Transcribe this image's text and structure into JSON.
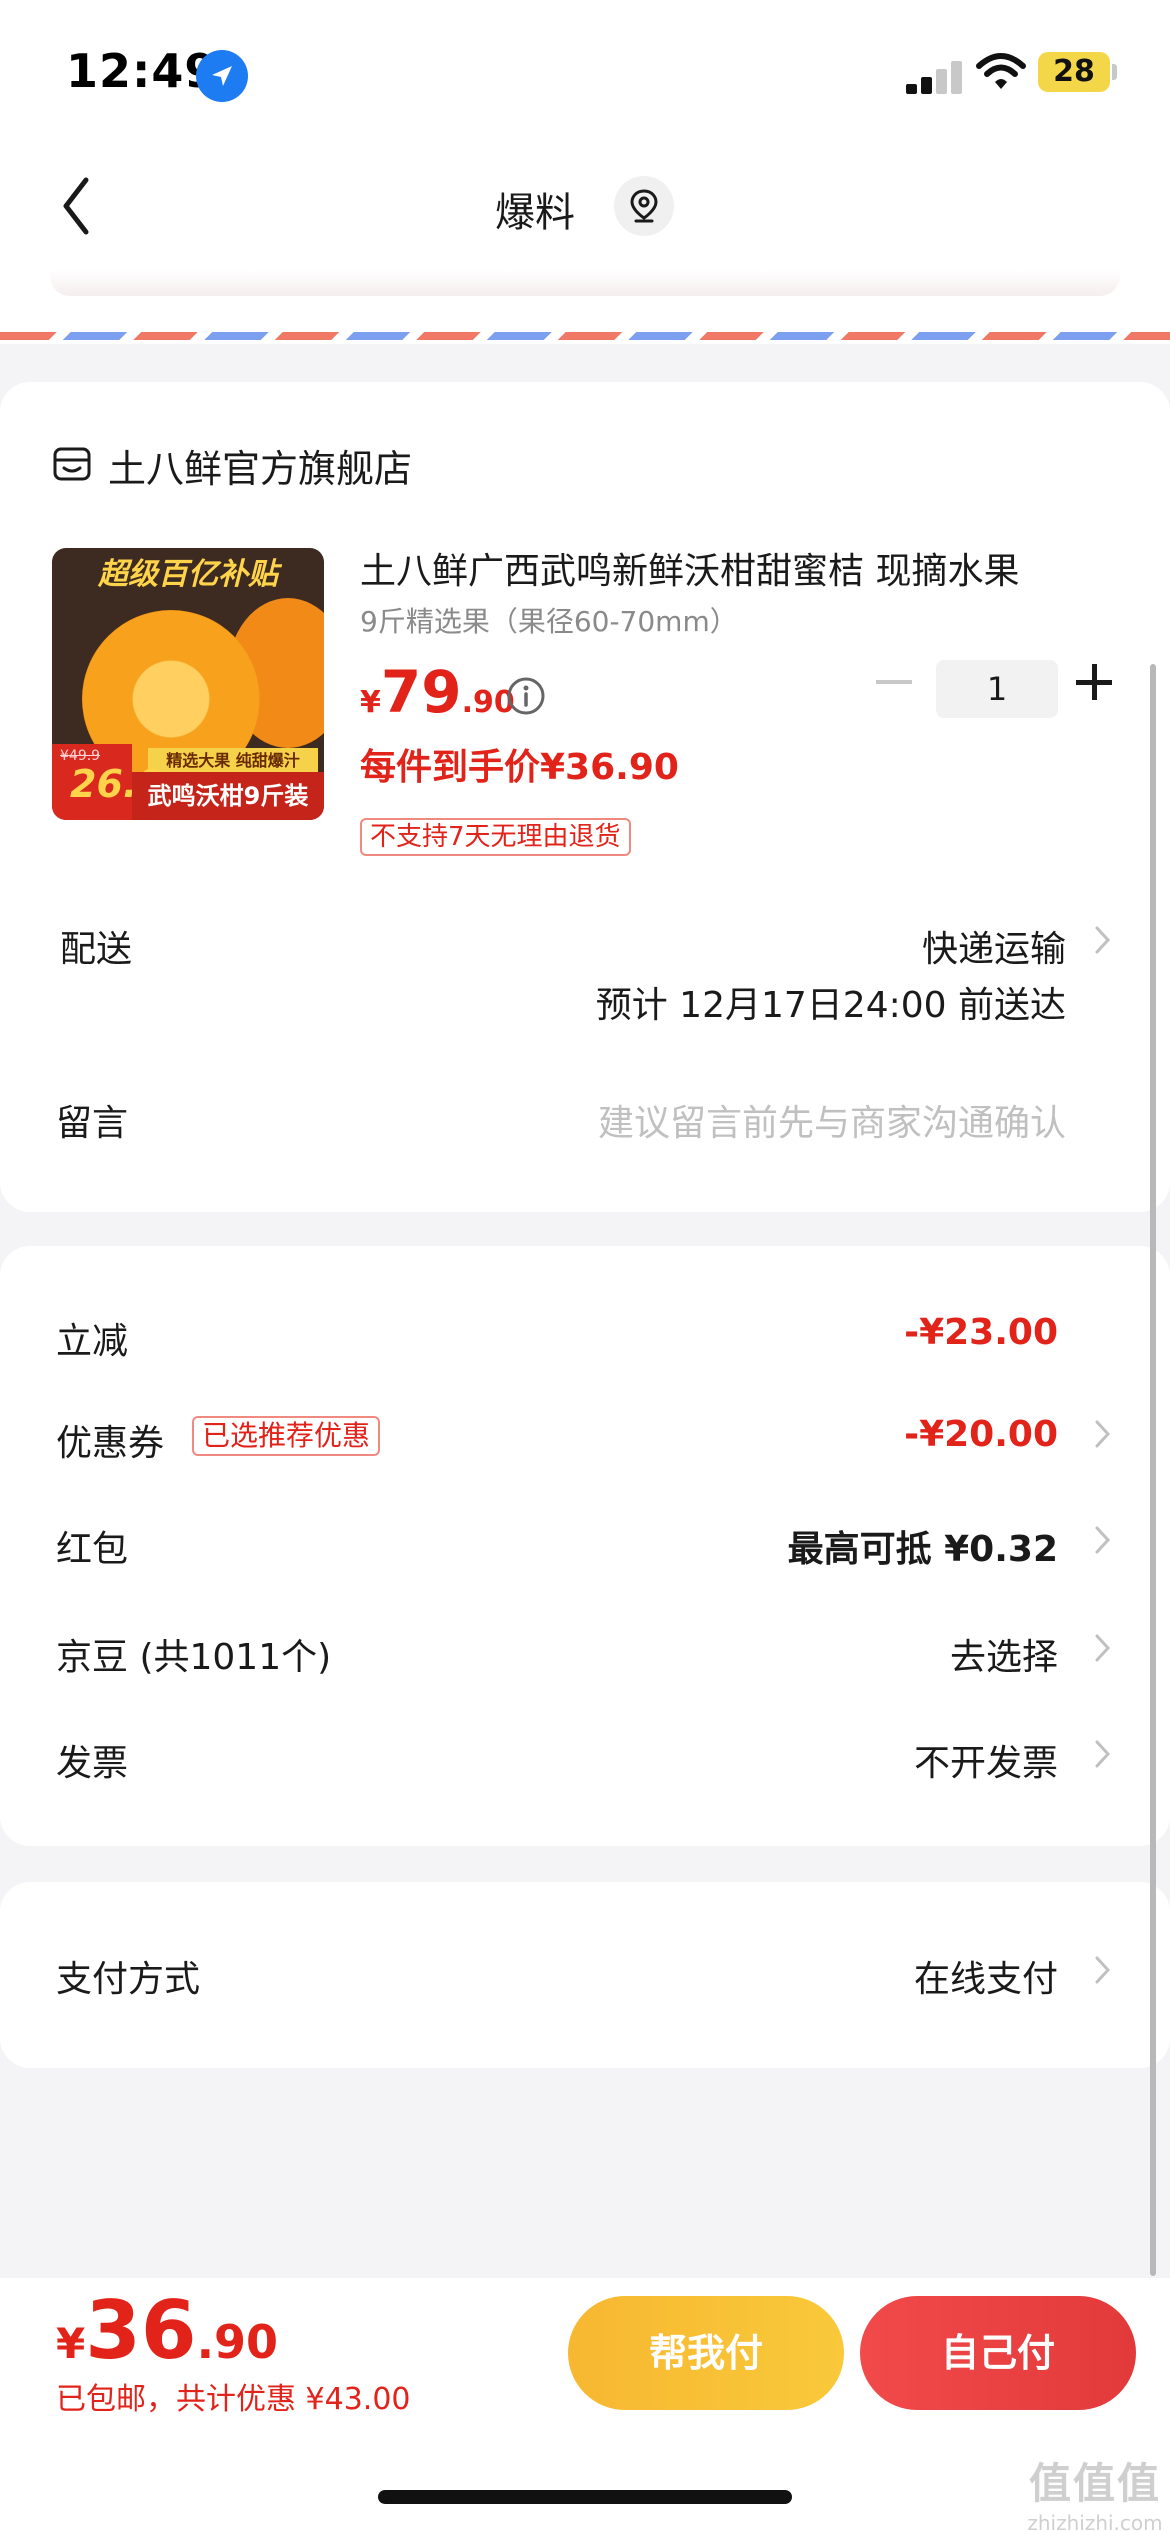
{
  "status_bar": {
    "time": "12:49",
    "battery": "28"
  },
  "nav": {
    "title": "爆料"
  },
  "shop": {
    "name": "土八鲜官方旗舰店"
  },
  "product": {
    "image_banner": "超级百亿补贴",
    "image_old_price": "¥49.9",
    "image_new_price": "26.9",
    "image_mid": "精选大果 纯甜爆汁",
    "image_bottom": "武鸣沃柑9斤装",
    "title": "土八鲜广西武鸣新鲜沃柑甜蜜桔 现摘水果",
    "spec": "9斤精选果（果径60-70mm）",
    "price_currency": "¥",
    "price_int": "79",
    "price_dec": ".90",
    "quantity": "1",
    "hand_price": "每件到手价¥36.90",
    "return_policy": "不支持7天无理由退货"
  },
  "delivery": {
    "label": "配送",
    "method": "快递运输",
    "eta": "预计 12月17日24:00 前送达"
  },
  "message": {
    "label": "留言",
    "placeholder": "建议留言前先与商家沟通确认"
  },
  "discounts": {
    "instant_label": "立减",
    "instant_value": "-¥23.00",
    "coupon_label": "优惠券",
    "coupon_tag": "已选推荐优惠",
    "coupon_value": "-¥20.00",
    "redpacket_label": "红包",
    "redpacket_value": "最高可抵 ¥0.32",
    "beans_label": "京豆 (共1011个)",
    "beans_value": "去选择",
    "invoice_label": "发票",
    "invoice_value": "不开发票"
  },
  "payment": {
    "label": "支付方式",
    "value": "在线支付"
  },
  "bottom": {
    "total_currency": "¥",
    "total_int": "36",
    "total_dec": ".90",
    "summary": "已包邮，共计优惠 ¥43.00",
    "help_pay": "帮我付",
    "self_pay": "自己付"
  },
  "watermark": {
    "big": "值值值",
    "small": "zhizhizhi.com"
  },
  "colors": {
    "price_red": "#e2231a",
    "help_btn": "#f7b731",
    "self_btn": "#e23a3a"
  }
}
